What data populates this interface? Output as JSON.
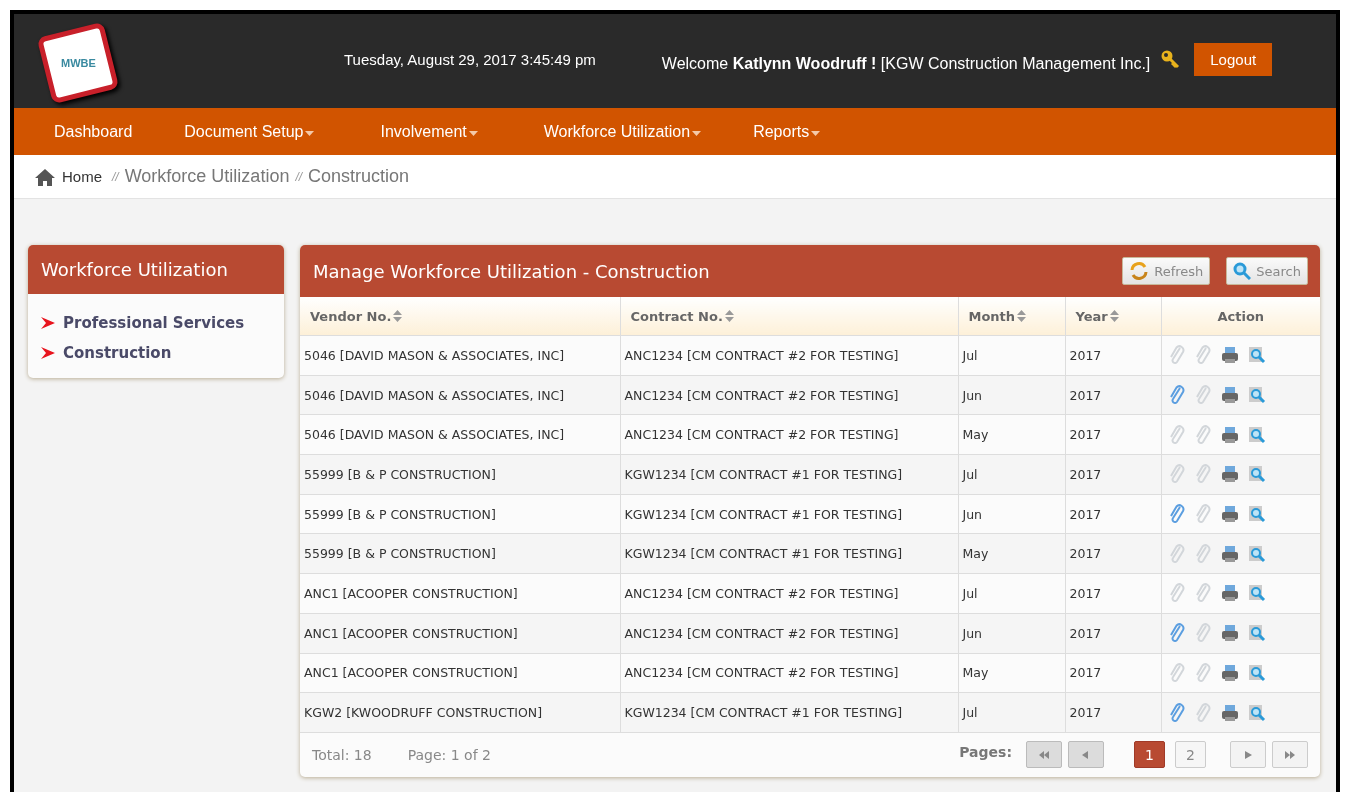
{
  "header": {
    "logo": "MWBE",
    "datetime": "Tuesday, August 29, 2017 3:45:49 pm",
    "welcome": "Welcome **Katlynn Woodruff !** [KGW Construction Management Inc.]",
    "logout": "Logout"
  },
  "nav": [
    {
      "label": "Dashboard",
      "dropdown": false
    },
    {
      "label": "Document Setup",
      "dropdown": true
    },
    {
      "label": "Involvement",
      "dropdown": true
    },
    {
      "label": "Workforce Utilization",
      "dropdown": true
    },
    {
      "label": "Reports",
      "dropdown": true
    }
  ],
  "breadcrumb": [
    {
      "label": "Home",
      "kind": "home"
    },
    {
      "label": "Workforce Utilization",
      "kind": "link",
      "sep": "//"
    },
    {
      "label": "Construction",
      "kind": "current",
      "sep": "//"
    }
  ],
  "sidebar": {
    "title": "Workforce Utilization",
    "items": [
      {
        "label": "Professional Services"
      },
      {
        "label": "Construction"
      }
    ]
  },
  "panel": {
    "title": "Manage Workforce Utilization - Construction",
    "buttons": [
      {
        "label": "Refresh",
        "kind": "refresh"
      },
      {
        "label": "Search",
        "kind": "search"
      }
    ]
  },
  "table": {
    "columns": [
      {
        "label": "Vendor No.",
        "sortable": true
      },
      {
        "label": "Contract No.",
        "sortable": true
      },
      {
        "label": "Month",
        "sortable": true
      },
      {
        "label": "Year",
        "sortable": true
      },
      {
        "label": "Action",
        "sortable": false
      }
    ],
    "rows": [
      {
        "vendor": "5046 [DAVID MASON & ASSOCIATES, INC]",
        "contract": "ANC1234 [CM CONTRACT #2 FOR TESTING]",
        "month": "Jul",
        "year": "2017",
        "attached": false
      },
      {
        "vendor": "5046 [DAVID MASON & ASSOCIATES, INC]",
        "contract": "ANC1234 [CM CONTRACT #2 FOR TESTING]",
        "month": "Jun",
        "year": "2017",
        "attached": true
      },
      {
        "vendor": "5046 [DAVID MASON & ASSOCIATES, INC]",
        "contract": "ANC1234 [CM CONTRACT #2 FOR TESTING]",
        "month": "May",
        "year": "2017",
        "attached": false
      },
      {
        "vendor": "55999 [B & P CONSTRUCTION]",
        "contract": "KGW1234 [CM CONTRACT #1 FOR TESTING]",
        "month": "Jul",
        "year": "2017",
        "attached": false
      },
      {
        "vendor": "55999 [B & P CONSTRUCTION]",
        "contract": "KGW1234 [CM CONTRACT #1 FOR TESTING]",
        "month": "Jun",
        "year": "2017",
        "attached": true
      },
      {
        "vendor": "55999 [B & P CONSTRUCTION]",
        "contract": "KGW1234 [CM CONTRACT #1 FOR TESTING]",
        "month": "May",
        "year": "2017",
        "attached": false
      },
      {
        "vendor": "ANC1 [ACOOPER CONSTRUCTION]",
        "contract": "ANC1234 [CM CONTRACT #2 FOR TESTING]",
        "month": "Jul",
        "year": "2017",
        "attached": false
      },
      {
        "vendor": "ANC1 [ACOOPER CONSTRUCTION]",
        "contract": "ANC1234 [CM CONTRACT #2 FOR TESTING]",
        "month": "Jun",
        "year": "2017",
        "attached": true
      },
      {
        "vendor": "ANC1 [ACOOPER CONSTRUCTION]",
        "contract": "ANC1234 [CM CONTRACT #2 FOR TESTING]",
        "month": "May",
        "year": "2017",
        "attached": false
      },
      {
        "vendor": "KGW2 [KWOODRUFF CONSTRUCTION]",
        "contract": "KGW1234 [CM CONTRACT #1 FOR TESTING]",
        "month": "Jul",
        "year": "2017",
        "attached": true
      }
    ]
  },
  "footer": {
    "total": "Total: 18",
    "page": "Page: 1 of 2",
    "pages_label": "Pages:",
    "nav": [
      {
        "kind": "first",
        "disabled": true
      },
      {
        "kind": "prev",
        "disabled": true
      }
    ],
    "pages": [
      {
        "label": "1",
        "selected": true
      },
      {
        "label": "2",
        "selected": false
      }
    ],
    "nav_after": [
      {
        "kind": "next",
        "disabled": false
      },
      {
        "kind": "last",
        "disabled": false
      }
    ]
  }
}
